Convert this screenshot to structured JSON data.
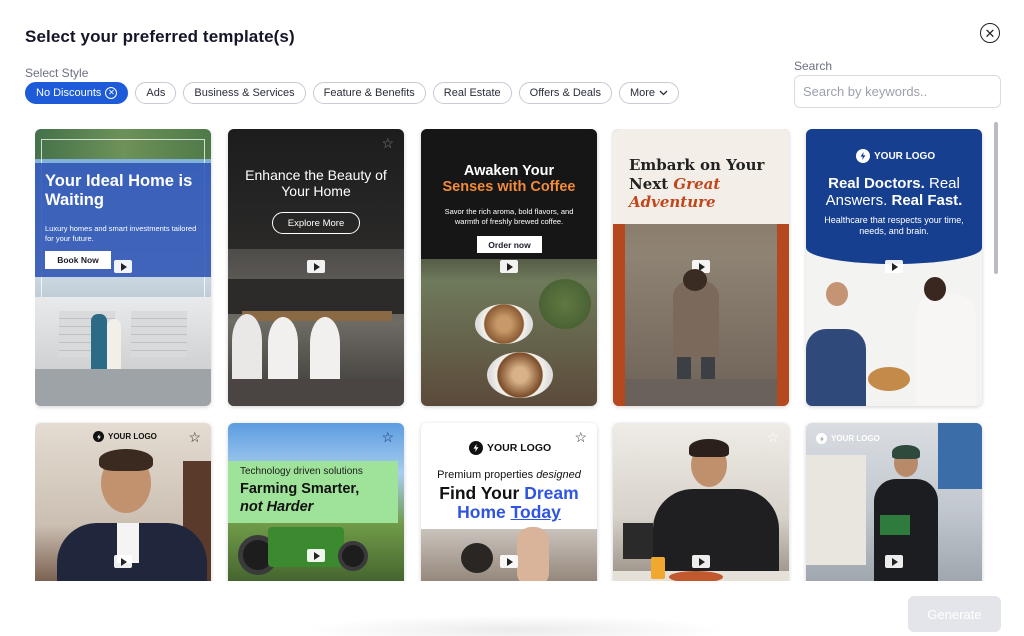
{
  "modal": {
    "title": "Select your preferred template(s)",
    "close_icon": "close-circle-icon",
    "style_label": "Select Style",
    "search_label": "Search",
    "search_placeholder": "Search by keywords..",
    "generate_label": "Generate",
    "accent": "#1d5bd8"
  },
  "chips": [
    {
      "label": "No Discounts",
      "active": true
    },
    {
      "label": "Ads"
    },
    {
      "label": "Business & Services"
    },
    {
      "label": "Feature & Benefits"
    },
    {
      "label": "Real Estate"
    },
    {
      "label": "Offers & Deals"
    },
    {
      "label": "More"
    }
  ],
  "templates": {
    "t1": {
      "heading": "Your Ideal Home is Waiting",
      "body": "Luxury homes and smart investments tailored for your future.",
      "button": "Book Now"
    },
    "t2": {
      "heading": "Enhance the Beauty of Your Home",
      "button": "Explore More"
    },
    "t3": {
      "heading_1": "Awaken Your",
      "heading_2": "Senses with Coffee",
      "body": "Savor the rich aroma, bold flavors, and warmth of freshly brewed coffee.",
      "button": "Order now"
    },
    "t4": {
      "heading_1": "Embark on Your",
      "heading_2": "Next",
      "heading_3": "Great",
      "heading_4": "Adventure"
    },
    "t5": {
      "logo": "YOUR LOGO",
      "heading_1": "Real Doctors.",
      "heading_2": "Real",
      "heading_3": "Answers.",
      "heading_4": "Real Fast.",
      "body": "Healthcare that respects your time, needs, and brain."
    },
    "t6": {
      "logo": "YOUR LOGO"
    },
    "t7": {
      "subheading": "Technology driven solutions",
      "heading_1": "Farming Smarter,",
      "heading_2": "not Harder"
    },
    "t8": {
      "logo": "YOUR LOGO",
      "sub_1": "Premium properties",
      "sub_2": "designed",
      "heading_1": "Find Your",
      "heading_2": "Dream",
      "heading_3": "Home",
      "heading_4": "Today"
    },
    "t9": {},
    "t10": {
      "logo": "YOUR LOGO"
    }
  }
}
